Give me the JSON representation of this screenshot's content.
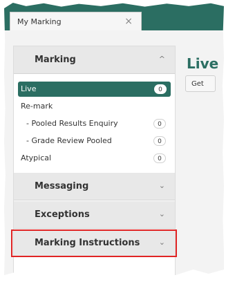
{
  "tabs": [
    {
      "label": "My Marking"
    }
  ],
  "sidebar": {
    "sections": [
      {
        "title": "Marking",
        "expanded": true
      },
      {
        "title": "Messaging"
      },
      {
        "title": "Exceptions"
      },
      {
        "title": "Marking Instructions"
      }
    ],
    "items": [
      {
        "label": "Live",
        "count": "0"
      },
      {
        "label": "Re-mark"
      },
      {
        "label": "- Pooled Results Enquiry",
        "count": "0"
      },
      {
        "label": "- Grade Review Pooled",
        "count": "0"
      },
      {
        "label": "Atypical",
        "count": "0"
      }
    ]
  },
  "main": {
    "title": "Live",
    "button_label": "Get"
  },
  "colors": {
    "brand": "#2b6e62",
    "highlight": "#e02424"
  },
  "icons": {
    "tab_close": "close-icon",
    "expand": "chevron-up-icon",
    "collapse": "chevron-down-icon"
  }
}
